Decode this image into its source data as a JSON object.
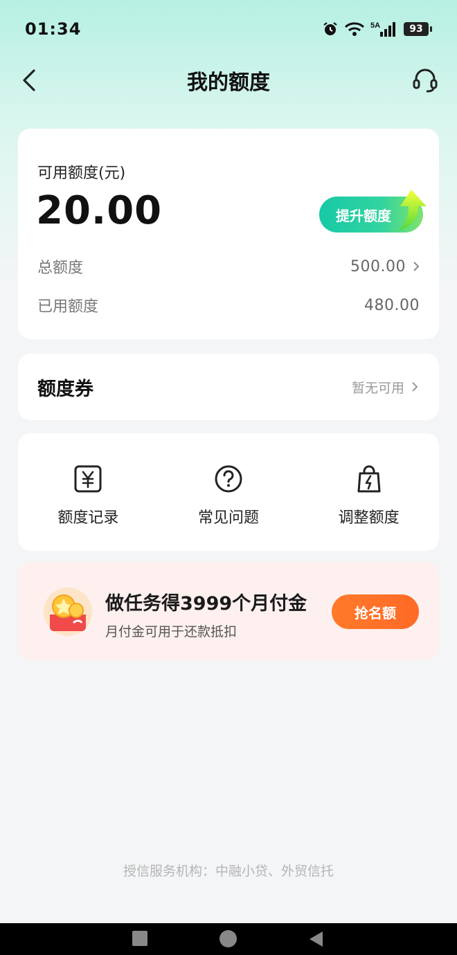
{
  "status_bar": {
    "time": "01:34",
    "network_label": "5A",
    "battery": "93"
  },
  "nav": {
    "title": "我的额度"
  },
  "quota": {
    "available_label": "可用额度(元)",
    "available_amount": "20.00",
    "raise_button": "提升额度",
    "total_label": "总额度",
    "total_value": "500.00",
    "used_label": "已用额度",
    "used_value": "480.00"
  },
  "coupon": {
    "title": "额度券",
    "status": "暂无可用"
  },
  "actions": [
    {
      "label": "额度记录",
      "icon": "yuan-receipt-icon"
    },
    {
      "label": "常见问题",
      "icon": "question-circle-icon"
    },
    {
      "label": "调整额度",
      "icon": "bolt-bag-icon"
    }
  ],
  "promo": {
    "title": "做任务得3999个月付金",
    "subtitle": "月付金可用于还款抵扣",
    "button": "抢名额"
  },
  "footer": {
    "note": "授信服务机构：中融小贷、外贸信托"
  },
  "colors": {
    "accent_green": "#1fcaa6",
    "promo_orange": "#ff7328",
    "header_mint": "#b6f0e3"
  }
}
